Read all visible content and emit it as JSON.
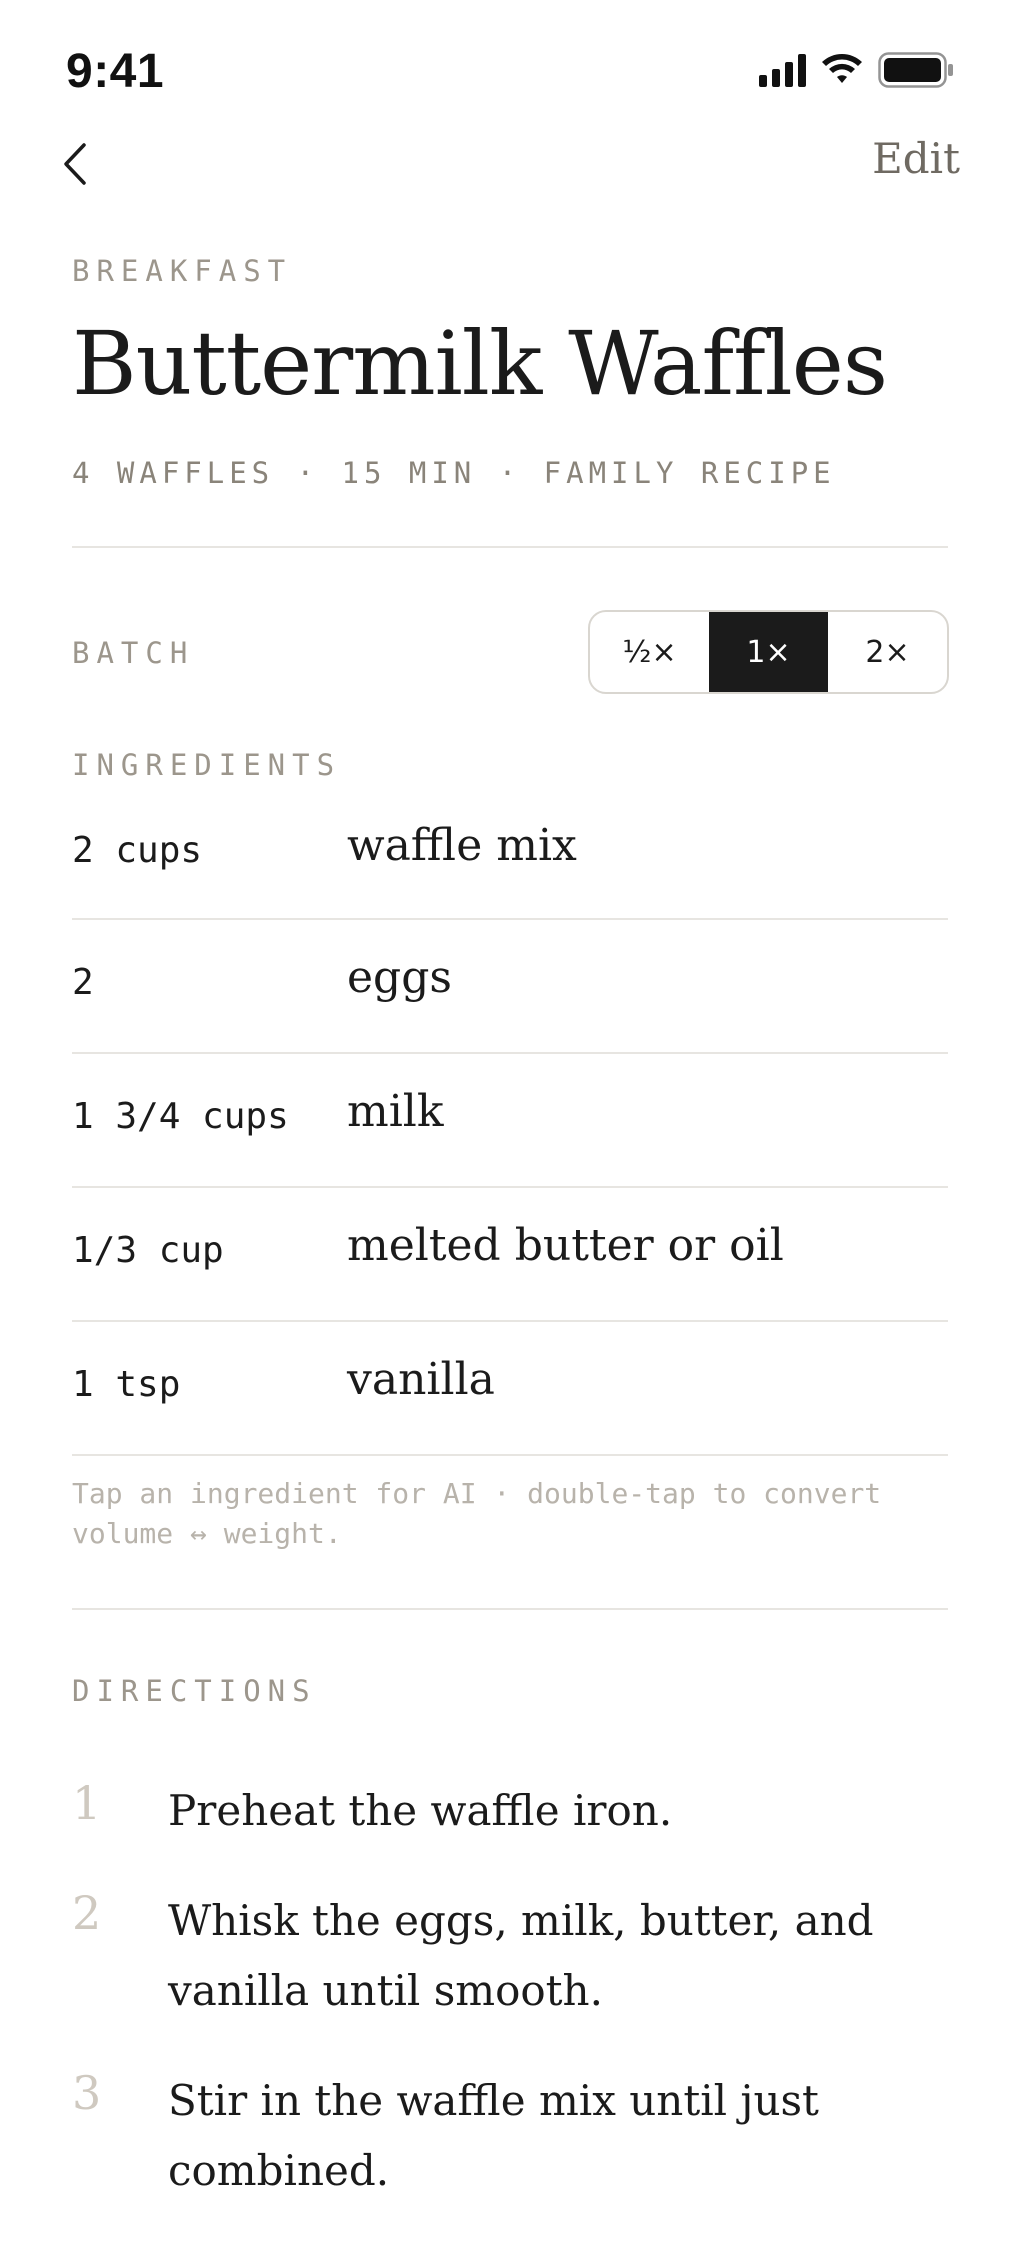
{
  "status_bar": {
    "time": "9:41"
  },
  "nav": {
    "edit_label": "Edit"
  },
  "recipe": {
    "category": "BREAKFAST",
    "title": "Buttermilk Waffles",
    "meta": "4 WAFFLES · 15 MIN · FAMILY RECIPE"
  },
  "batch": {
    "label": "BATCH",
    "options": [
      "½×",
      "1×",
      "2×"
    ],
    "selected": "1×"
  },
  "ingredients": {
    "label": "INGREDIENTS",
    "items": [
      {
        "qty": "2 cups",
        "name": "waffle mix"
      },
      {
        "qty": "2",
        "name": "eggs"
      },
      {
        "qty": "1 3/4 cups",
        "name": "milk"
      },
      {
        "qty": "1/3 cup",
        "name": "melted butter or oil"
      },
      {
        "qty": "1 tsp",
        "name": "vanilla"
      }
    ],
    "hint": "Tap an ingredient for AI · double-tap to convert volume ↔ weight."
  },
  "directions": {
    "label": "DIRECTIONS",
    "steps": [
      {
        "num": "1",
        "text": "Preheat the waffle iron."
      },
      {
        "num": "2",
        "text": "Whisk the eggs, milk, butter, and vanilla until smooth."
      },
      {
        "num": "3",
        "text": "Stir in the waffle mix until just combined."
      }
    ]
  },
  "colors": {
    "accent": "#1b1b1b",
    "muted": "#9c968c",
    "divider": "#e7e5e1"
  }
}
